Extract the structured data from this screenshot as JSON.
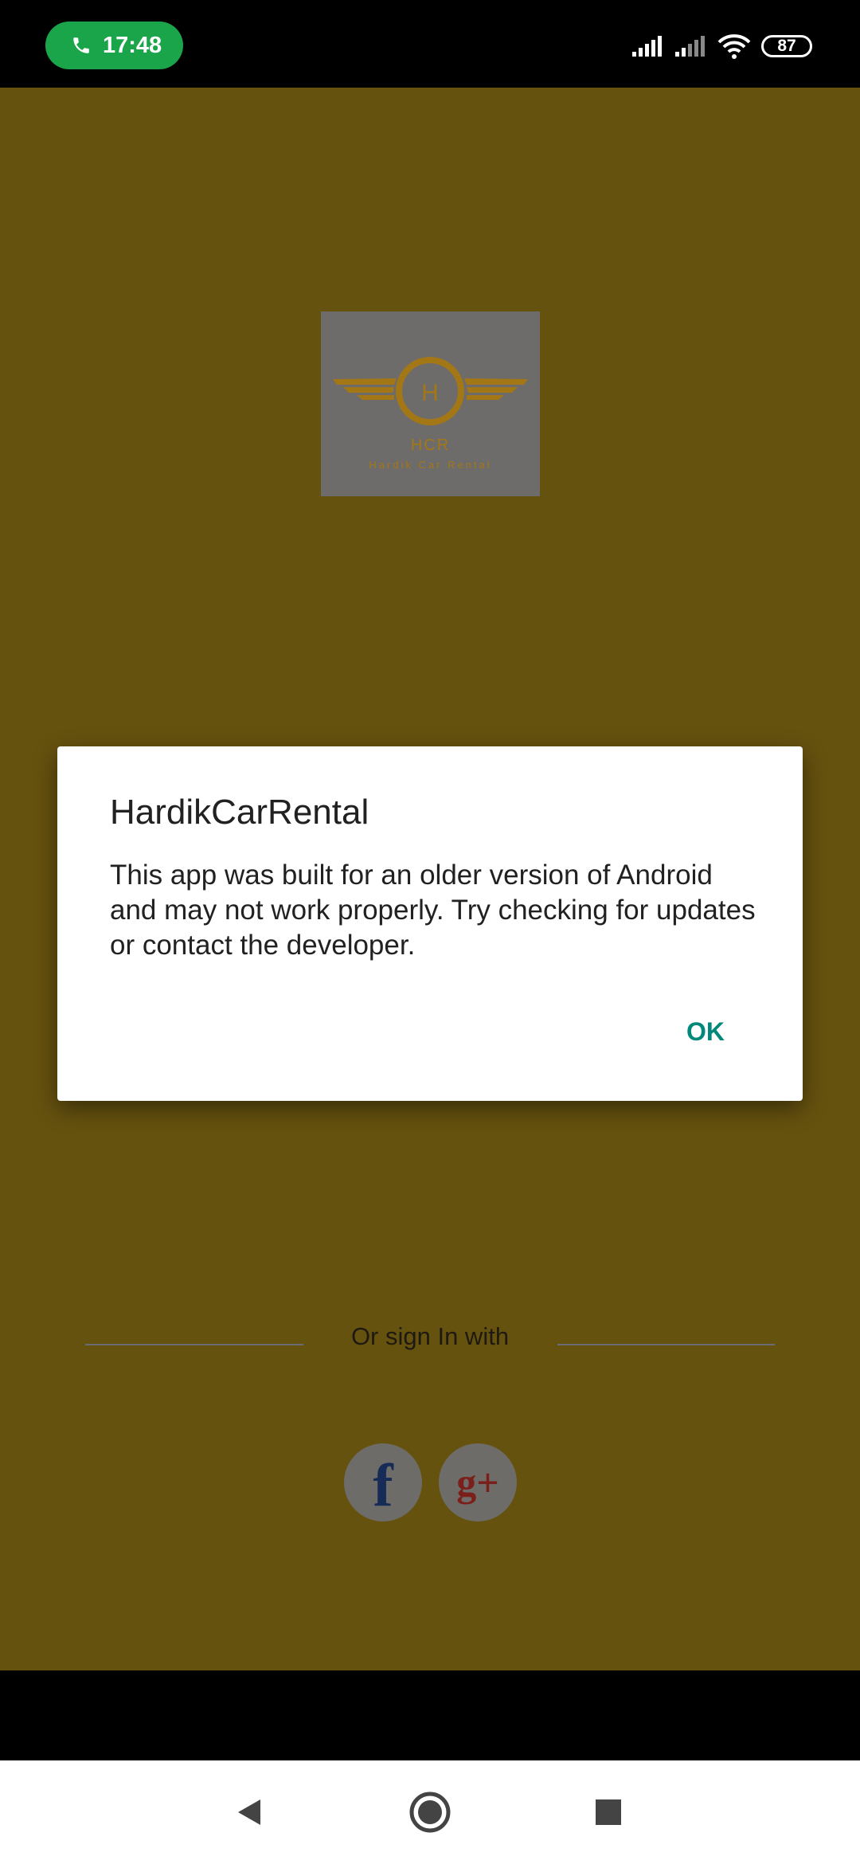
{
  "status_bar": {
    "call_time": "17:48",
    "battery_level": "87",
    "icons": [
      "phone-icon",
      "signal-icon",
      "signal-icon",
      "wifi-icon",
      "battery-icon"
    ]
  },
  "app": {
    "logo": {
      "letter": "H",
      "abbreviation": "HCR",
      "name": "Hardik Car Rental"
    },
    "or_sign_in_text": "Or sign In with",
    "social": {
      "facebook_glyph": "f",
      "google_plus_glyph": "g+"
    }
  },
  "dialog": {
    "title": "HardikCarRental",
    "message": "This app was built for an older version of Android and may not work properly. Try checking for updates or contact the developer.",
    "ok_label": "OK"
  },
  "colors": {
    "background_dimmed": "#66520f",
    "call_pill": "#1aa54a",
    "accent": "#00897b"
  }
}
